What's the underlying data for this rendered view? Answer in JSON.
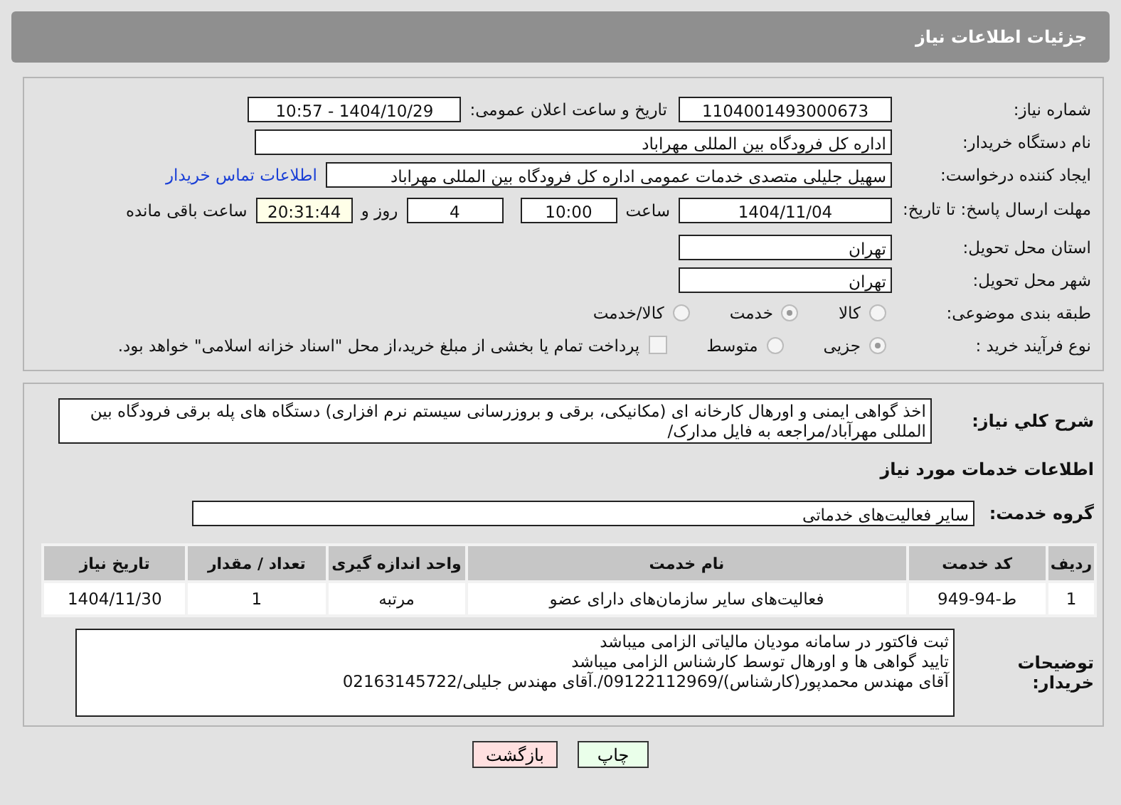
{
  "header": {
    "title": "جزئیات اطلاعات نیاز"
  },
  "need_number": {
    "label": "شماره نیاز:",
    "value": "1104001493000673"
  },
  "announce": {
    "label": "تاریخ و ساعت اعلان عمومی:",
    "value": "1404/10/29 - 10:57"
  },
  "buyer_org": {
    "label": "نام دستگاه خریدار:",
    "value": "اداره کل فرودگاه بین المللی مهراباد"
  },
  "creator": {
    "label": "ایجاد کننده درخواست:",
    "value": "سهیل جلیلی متصدی خدمات عمومی اداره کل فرودگاه بین المللی مهراباد",
    "link": "اطلاعات تماس خریدار"
  },
  "deadline": {
    "label": "مهلت ارسال پاسخ: تا تاریخ:",
    "date": "1404/11/04",
    "time_label": "ساعت",
    "time": "10:00",
    "days": "4",
    "days_label": "روز و",
    "remaining": "20:31:44",
    "remaining_label": "ساعت باقی مانده"
  },
  "province": {
    "label": "استان محل تحویل:",
    "value": "تهران"
  },
  "city": {
    "label": "شهر محل تحویل:",
    "value": "تهران"
  },
  "category": {
    "label": "طبقه بندی موضوعی:",
    "options": [
      {
        "label": "کالا",
        "selected": false
      },
      {
        "label": "خدمت",
        "selected": true
      },
      {
        "label": "کالا/خدمت",
        "selected": false
      }
    ]
  },
  "process": {
    "label": "نوع فرآیند خرید :",
    "options": [
      {
        "label": "جزیی",
        "selected": true
      },
      {
        "label": "متوسط",
        "selected": false
      }
    ],
    "checkbox": {
      "label": "پرداخت تمام یا بخشی از مبلغ خرید،از محل \"اسناد خزانه اسلامی\" خواهد بود.",
      "checked": false
    }
  },
  "description": {
    "label": "شرح کلي نياز:",
    "value": "اخذ گواهی ایمنی و اورهال کارخانه ای (مکانیکی، برقی و بروزرسانی سیستم نرم افزاری) دستگاه های پله برقی فرودگاه بین المللی مهرآباد/مراجعه به فایل مدارک/"
  },
  "services_title": "اطلاعات خدمات مورد نیاز",
  "service_group": {
    "label": "گروه خدمت:",
    "value": "سایر فعالیت‌های خدماتی"
  },
  "table": {
    "columns": [
      "ردیف",
      "کد خدمت",
      "نام خدمت",
      "واحد اندازه گیری",
      "تعداد / مقدار",
      "تاریخ نیاز"
    ],
    "rows": [
      [
        "1",
        "ط-94-949",
        "فعالیت‌های سایر سازمان‌های دارای عضو",
        "مرتبه",
        "1",
        "1404/11/30"
      ]
    ]
  },
  "buyer_notes": {
    "label": "توضیحات خریدار:",
    "lines": [
      "ثبت فاکتور در سامانه مودیان مالیاتی الزامی میباشد",
      "تایید گواهی ها و اورهال توسط کارشناس الزامی میباشد",
      "آقای مهندس محمدپور(کارشناس)/09122112969/.آقای مهندس جلیلی/02163145722"
    ]
  },
  "buttons": [
    {
      "label": "چاپ",
      "kind": "print"
    },
    {
      "label": "بازگشت",
      "kind": "back"
    }
  ]
}
